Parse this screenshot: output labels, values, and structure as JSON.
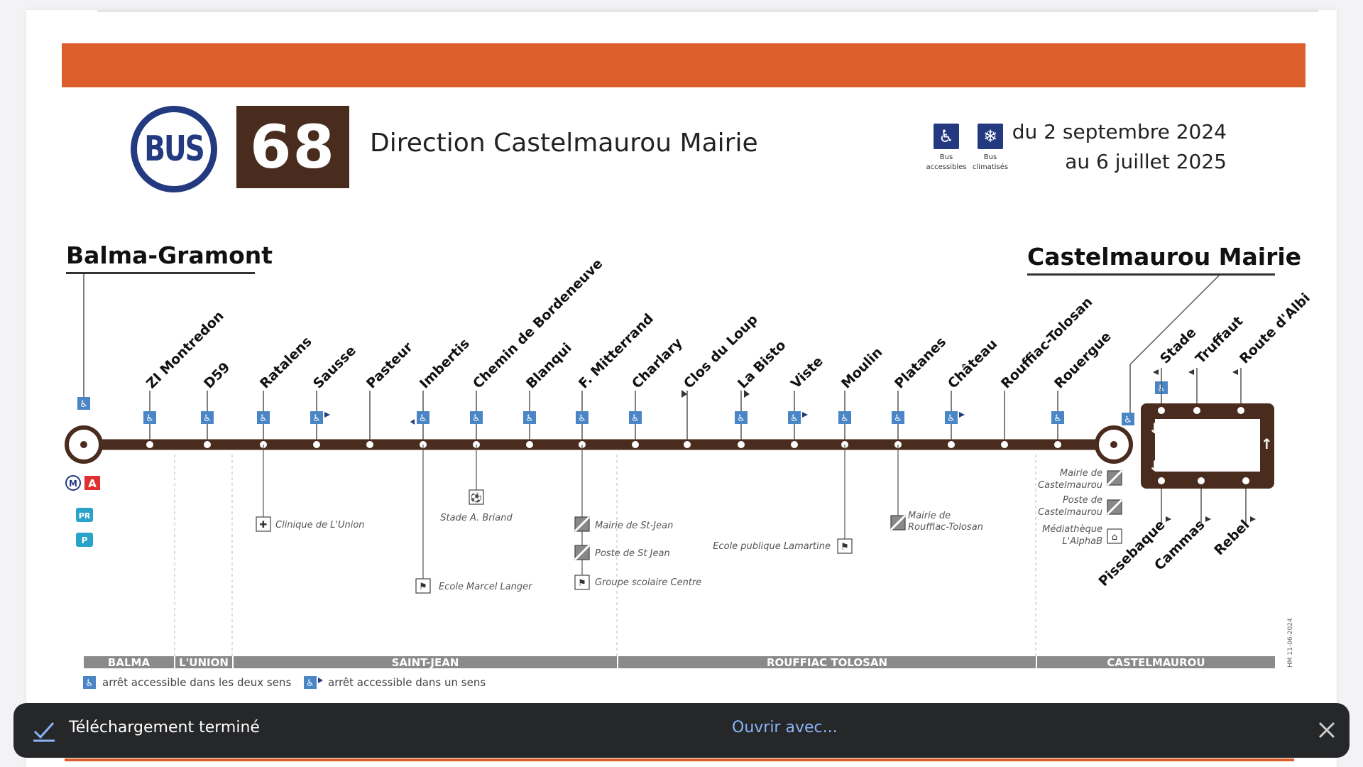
{
  "header": {
    "bus_logo": "BUS",
    "line_number": "68",
    "direction": "Direction Castelmaurou Mairie",
    "features": [
      {
        "icon": "wheelchair-icon",
        "caption": "Bus accessibles"
      },
      {
        "icon": "snowflake-icon",
        "caption": "Bus climatisés"
      }
    ],
    "dates": [
      "du 2 septembre 2024",
      "au 6 juillet 2025"
    ]
  },
  "termini": {
    "start": "Balma-Gramont",
    "end": "Castelmaurou Mairie"
  },
  "stops": [
    "ZI Montredon",
    "D59",
    "Ratalens",
    "Sausse",
    "Pasteur",
    "Imbertis",
    "Chemin de Bordeneuve",
    "Blanqui",
    "F. Mitterrand",
    "Charlary",
    "Clos du Loup",
    "La Bisto",
    "Viste",
    "Moulin",
    "Platanes",
    "Château",
    "Rouffiac-Tolosan",
    "Rouergue"
  ],
  "loop_stops_top": [
    "Stade",
    "Truffaut",
    "Route d'Albi"
  ],
  "loop_stops_bottom": [
    "Pissebaque",
    "Cammas",
    "Rebel"
  ],
  "pois": {
    "clinique": "Clinique de L'Union",
    "stade": "Stade A. Briand",
    "ecole_langer": "Ecole Marcel Langer",
    "mairie_stjean": "Mairie de St-Jean",
    "poste_stjean": "Poste de St Jean",
    "groupe_scolaire": "Groupe scolaire Centre",
    "ecole_lamartine": "Ecole publique Lamartine",
    "mairie_rouffiac": [
      "Mairie de",
      "Rouffiac-Tolosan"
    ],
    "mairie_castel": [
      "Mairie de",
      "Castelmaurou"
    ],
    "poste_castel": [
      "Poste de",
      "Castelmaurou"
    ],
    "mediatheque": [
      "Médiathèque",
      "L'AlphaB"
    ]
  },
  "communes": [
    "BALMA",
    "L'UNION",
    "SAINT-JEAN",
    "ROUFFIAC TOLOSAN",
    "CASTELMAUROU"
  ],
  "legend": {
    "both": "arrêt accessible dans les deux sens",
    "one": "arrêt accessible dans un sens"
  },
  "revision": "HM 11-06-2024",
  "transfer_badges": [
    "M",
    "A",
    "PR",
    "P"
  ],
  "toast": {
    "message": "Téléchargement terminé",
    "action": "Ouvrir avec..."
  },
  "colors": {
    "orange": "#dc5e2a",
    "brown": "#4a2c1f",
    "navy": "#233a80",
    "access": "#4a86c5"
  }
}
